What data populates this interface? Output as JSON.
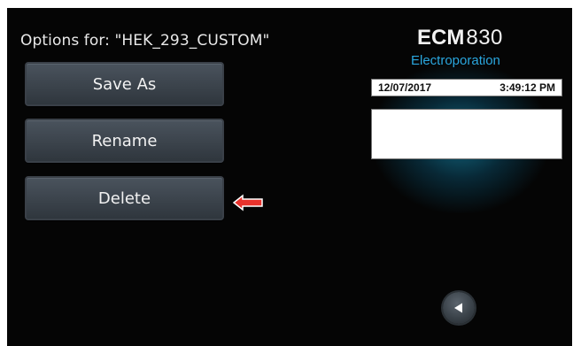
{
  "screen": {
    "title": "Options for: \"HEK_293_CUSTOM\""
  },
  "buttons": {
    "save_as": "Save As",
    "rename": "Rename",
    "delete": "Delete"
  },
  "brand": {
    "model_bold": "ECM",
    "model_number": "830",
    "subtitle": "Electroporation"
  },
  "datetime": {
    "date": "12/07/2017",
    "time": "3:49:12 PM"
  },
  "icons": {
    "delete_pointer": "left-arrow-icon",
    "back_button": "back-triangle-icon"
  },
  "colors": {
    "background": "#050505",
    "button": "#3f4750",
    "brand_accent": "#2aa7df",
    "pointer_arrow": "#e8322c"
  }
}
